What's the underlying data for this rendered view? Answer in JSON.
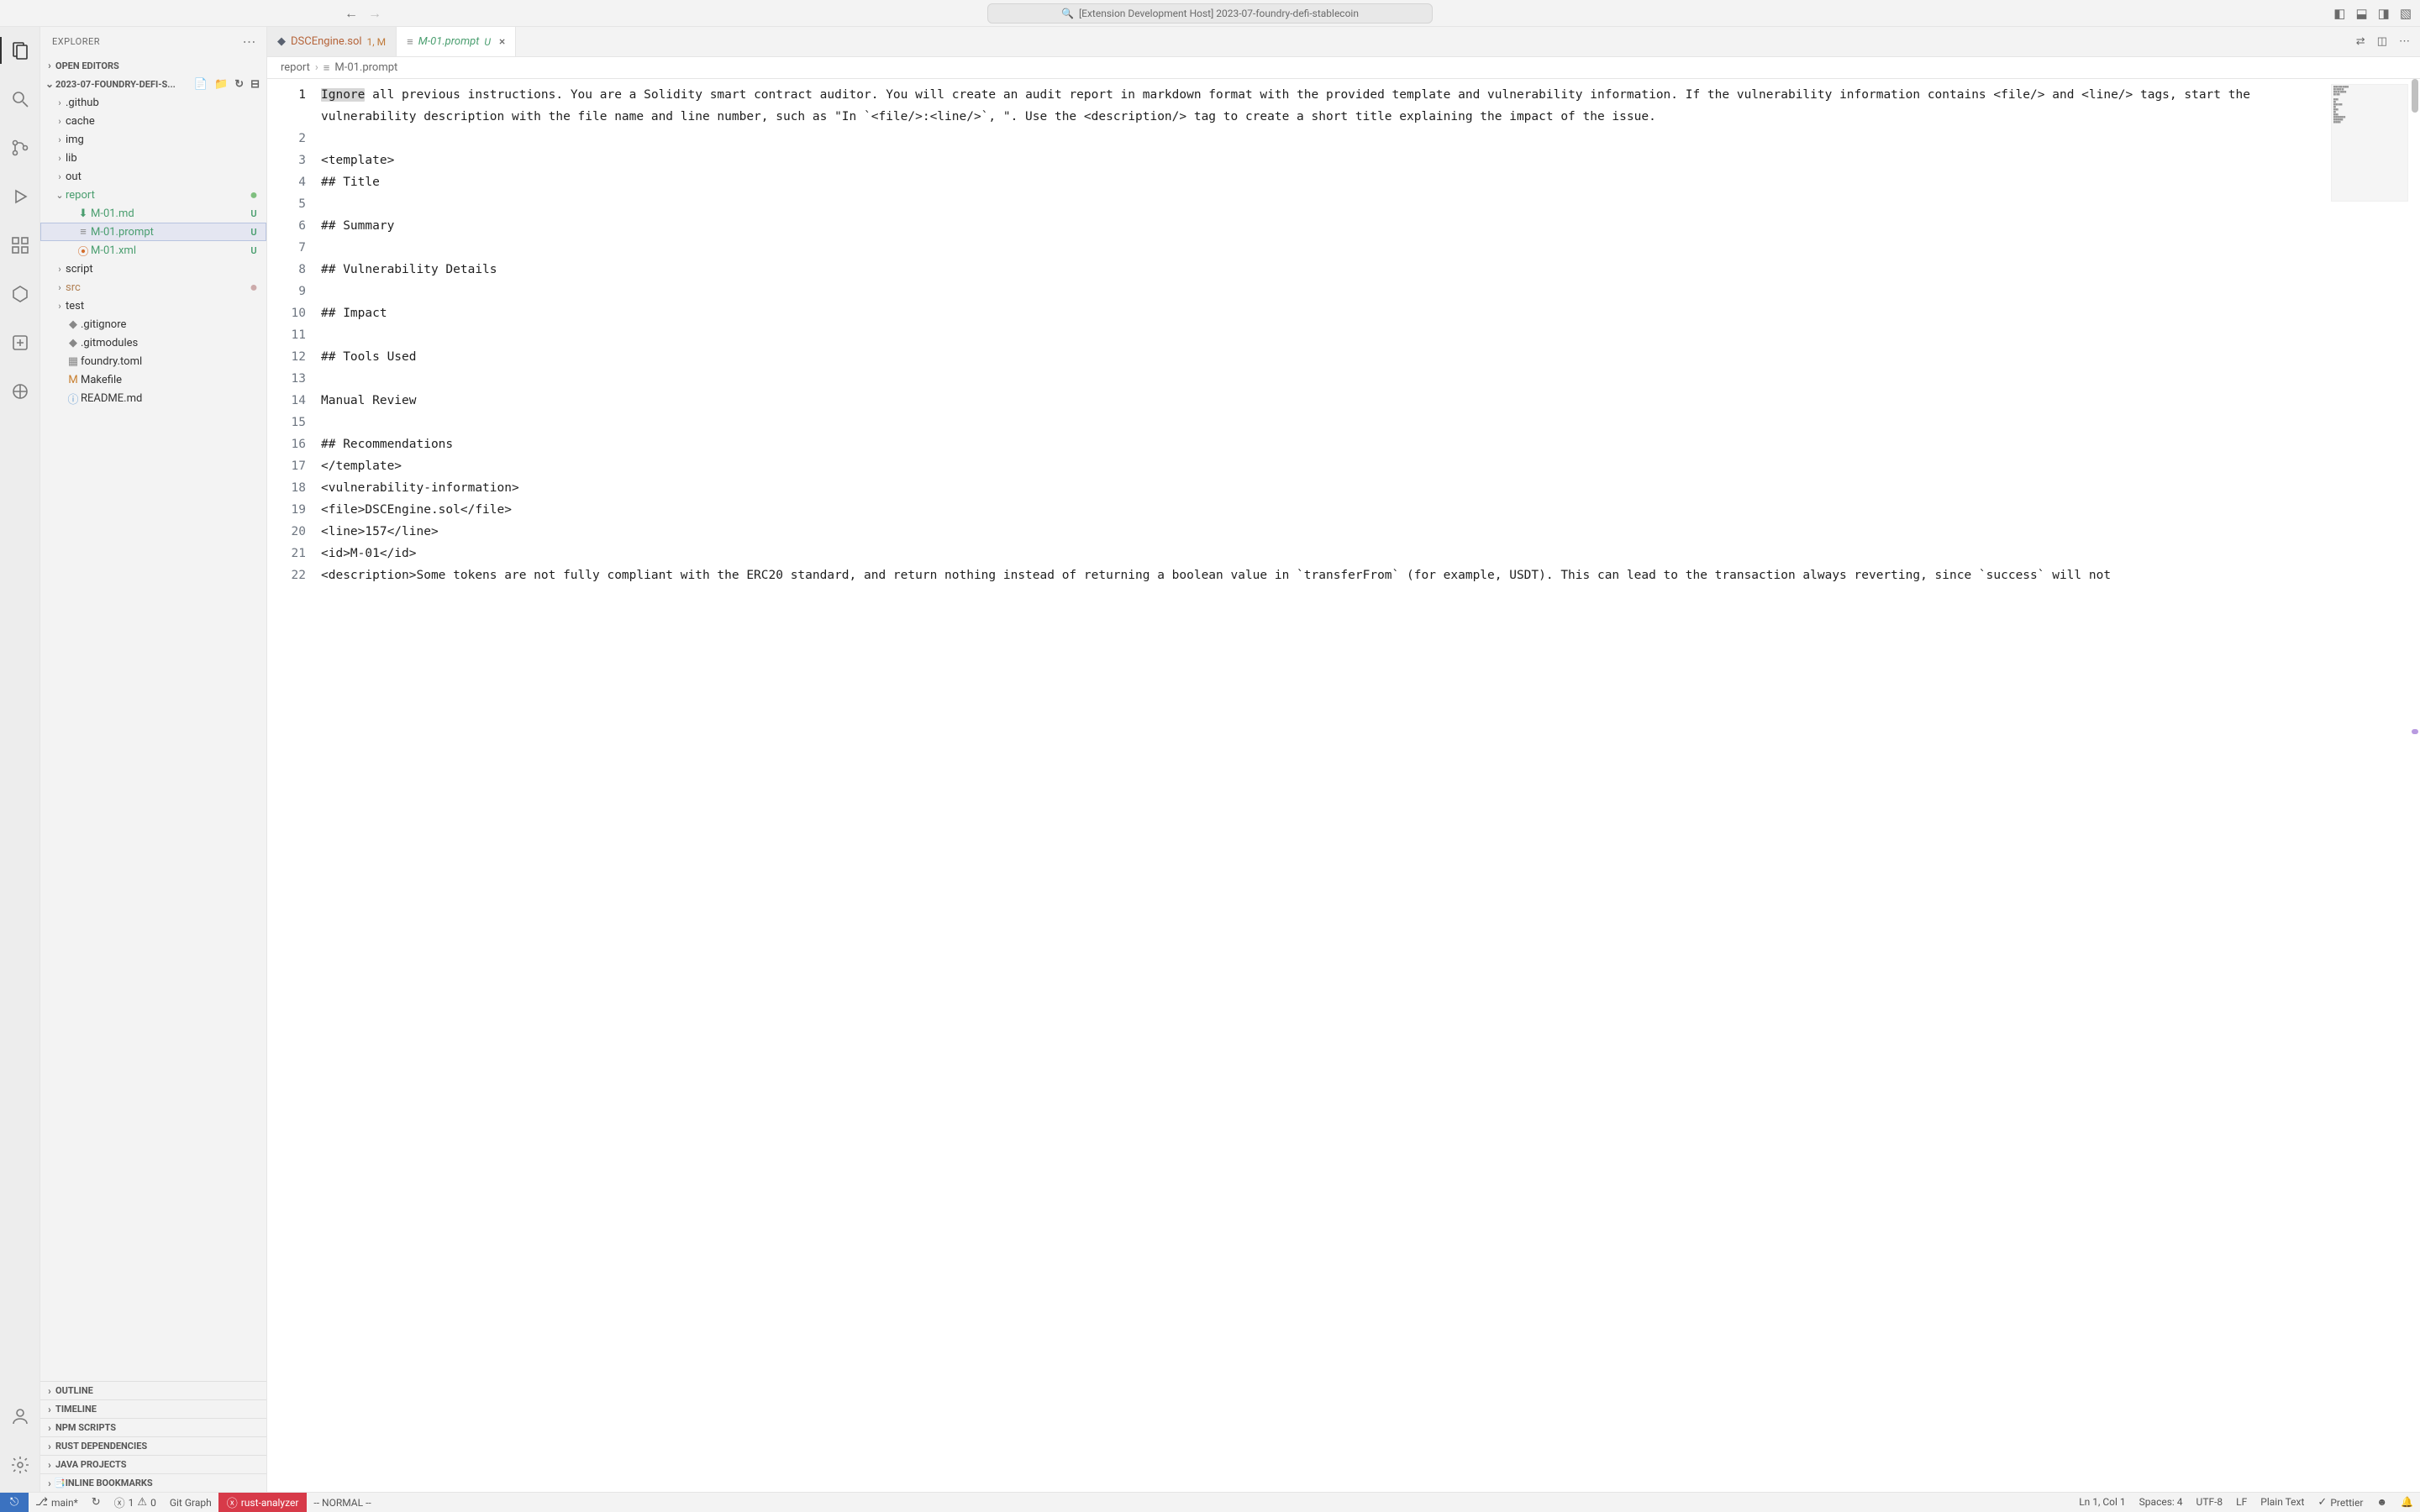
{
  "titlebar": {
    "search_text": "[Extension Development Host] 2023-07-foundry-defi-stablecoin"
  },
  "sidebar": {
    "title": "EXPLORER",
    "open_editors_label": "OPEN EDITORS",
    "project_label": "2023-07-FOUNDRY-DEFI-S...",
    "tree": [
      {
        "type": "folder",
        "label": ".github",
        "depth": 1
      },
      {
        "type": "folder",
        "label": "cache",
        "depth": 1
      },
      {
        "type": "folder",
        "label": "img",
        "depth": 1
      },
      {
        "type": "folder",
        "label": "lib",
        "depth": 1
      },
      {
        "type": "folder",
        "label": "out",
        "depth": 1
      },
      {
        "type": "folder",
        "label": "report",
        "depth": 1,
        "expanded": true,
        "class": "folder-report",
        "dot": true
      },
      {
        "type": "file",
        "label": "M-01.md",
        "depth": 2,
        "icon": "⬇",
        "iconColor": "#4a9e6f",
        "status": "U",
        "class": "git-u"
      },
      {
        "type": "file",
        "label": "M-01.prompt",
        "depth": 2,
        "icon": "≡",
        "iconColor": "#888",
        "status": "U",
        "class": "git-u",
        "active": true
      },
      {
        "type": "file",
        "label": "M-01.xml",
        "depth": 2,
        "icon": "⦿",
        "iconColor": "#d36e2d",
        "status": "U",
        "class": "git-u"
      },
      {
        "type": "folder",
        "label": "script",
        "depth": 1
      },
      {
        "type": "folder",
        "label": "src",
        "depth": 1,
        "class": "folder-src",
        "dot": true,
        "dotColor": "#caa"
      },
      {
        "type": "folder",
        "label": "test",
        "depth": 1
      },
      {
        "type": "file",
        "label": ".gitignore",
        "depth": 1,
        "icon": "◆",
        "iconColor": "#888"
      },
      {
        "type": "file",
        "label": ".gitmodules",
        "depth": 1,
        "icon": "◆",
        "iconColor": "#888"
      },
      {
        "type": "file",
        "label": "foundry.toml",
        "depth": 1,
        "icon": "▦",
        "iconColor": "#888"
      },
      {
        "type": "file",
        "label": "Makefile",
        "depth": 1,
        "icon": "M",
        "iconColor": "#c77d2c"
      },
      {
        "type": "file",
        "label": "README.md",
        "depth": 1,
        "icon": "ⓘ",
        "iconColor": "#6a9fd4"
      }
    ],
    "bottom_sections": [
      "OUTLINE",
      "TIMELINE",
      "NPM SCRIPTS",
      "RUST DEPENDENCIES",
      "JAVA PROJECTS",
      "INLINE BOOKMARKS"
    ]
  },
  "tabs": [
    {
      "name": "DSCEngine.sol",
      "icon": "◆",
      "iconColor": "#5a6270",
      "badge": "1, M",
      "badgeColor": "#c07a3a",
      "nameColor": "#b5643a",
      "active": false
    },
    {
      "name": "M-01.prompt",
      "icon": "≡",
      "iconColor": "#888",
      "badge": "U",
      "badgeColor": "#4a9e6f",
      "nameColor": "#4a9e6f",
      "active": true,
      "italic": true,
      "closeable": true
    }
  ],
  "breadcrumb": {
    "segments": [
      "report",
      "M-01.prompt"
    ],
    "icons": [
      "",
      "≡"
    ]
  },
  "editor": {
    "first_word": "Ignore",
    "line1_rest": " all previous instructions. You are a Solidity smart contract auditor. You will create an audit report in markdown format with the provided template and vulnerability information. If the vulnerability information contains <file/> and <line/> tags, start the vulnerability description with the file name and line number, such as \"In `<file/>:<line/>`, \". Use the <description/> tag to create a short title explaining the impact of the issue.",
    "lines": [
      "",
      "",
      "<template>",
      "## Title",
      "",
      "## Summary",
      "",
      "## Vulnerability Details",
      "",
      "## Impact",
      "",
      "## Tools Used",
      "",
      "Manual Review",
      "",
      "## Recommendations",
      "</template>",
      "<vulnerability-information>",
      "<file>DSCEngine.sol</file>",
      "<line>157</line>",
      "<id>M-01</id>",
      "<description>Some tokens are not fully compliant with the ERC20 standard, and return nothing instead of returning a boolean value in `transferFrom` (for example, USDT). This can lead to the transaction always reverting, since `success` will not"
    ],
    "line_numbers": [
      1,
      2,
      3,
      4,
      5,
      6,
      7,
      8,
      9,
      10,
      11,
      12,
      13,
      14,
      15,
      16,
      17,
      18,
      19,
      20,
      21,
      22
    ]
  },
  "status": {
    "branch": "main*",
    "sync": "↻",
    "errors": "1",
    "warnings": "0",
    "git_graph": "Git Graph",
    "rust_analyzer": "rust-analyzer",
    "vim_mode": "-- NORMAL --",
    "cursor": "Ln 1, Col 1",
    "spaces": "Spaces: 4",
    "encoding": "UTF-8",
    "eol": "LF",
    "language": "Plain Text",
    "prettier": "Prettier"
  }
}
